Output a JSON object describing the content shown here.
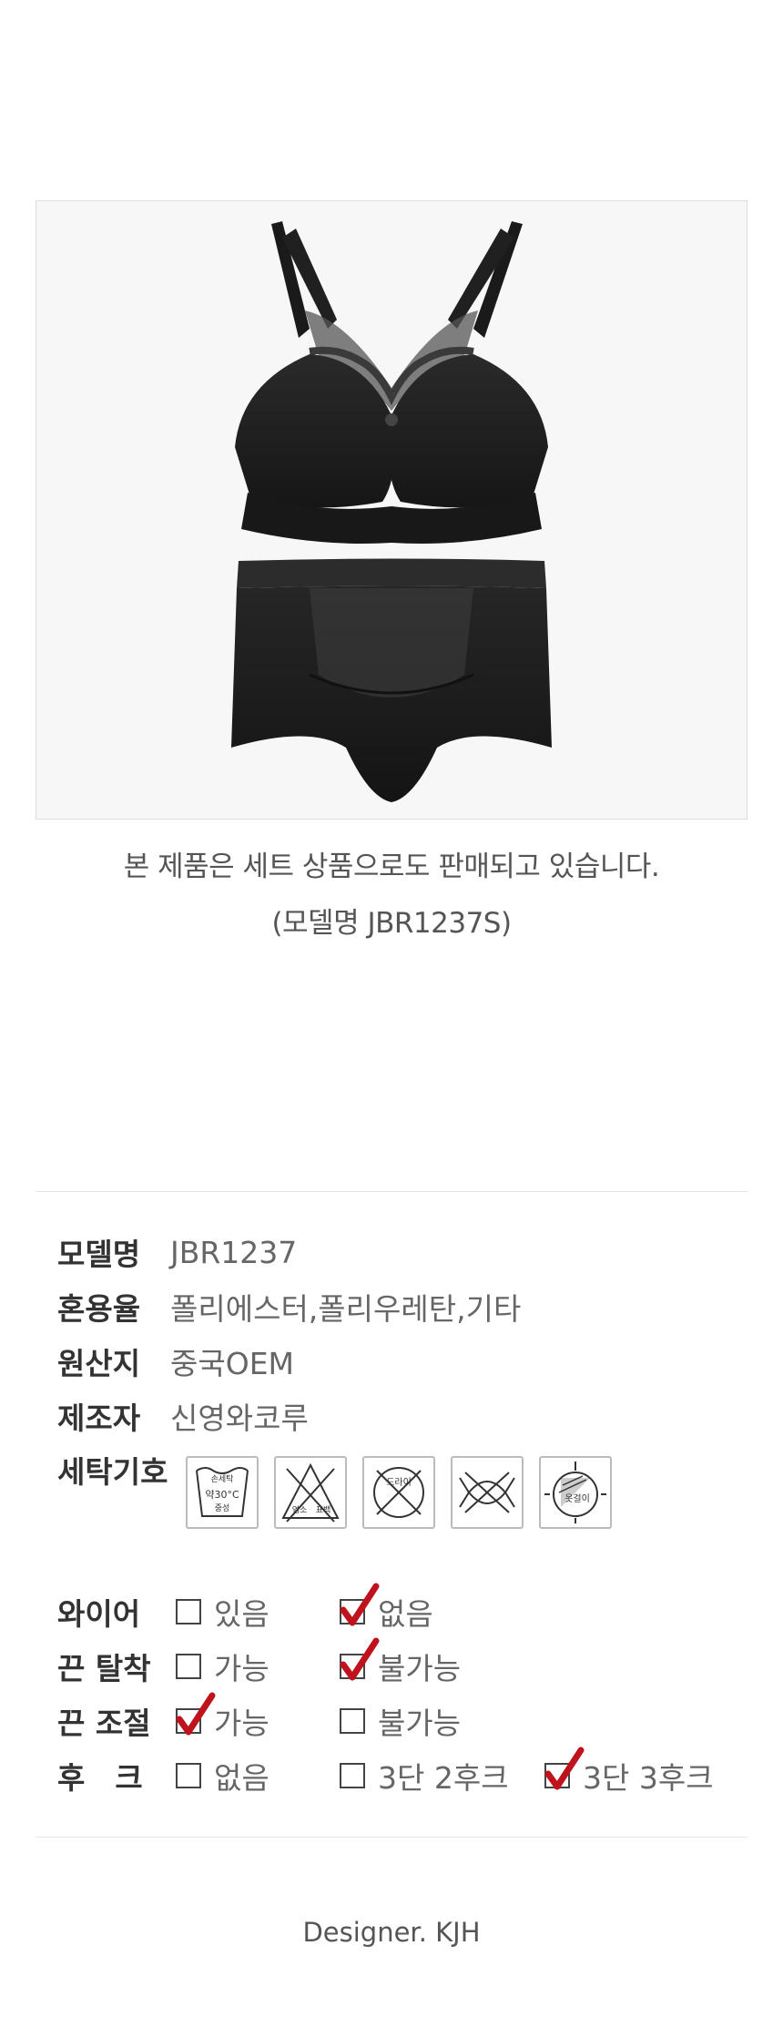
{
  "product_image": {
    "alt": "black bra and panty set"
  },
  "caption": {
    "line1": "본 제품은 세트 상품으로도 판매되고 있습니다.",
    "line2": "(모델명 JBR1237S)"
  },
  "info": [
    {
      "label": "모델명",
      "value": "JBR1237"
    },
    {
      "label": "혼용율",
      "value": "폴리에스터,폴리우레탄,기타"
    },
    {
      "label": "원산지",
      "value": "중국OEM"
    },
    {
      "label": "제조자",
      "value": "신영와코루"
    }
  ],
  "wash": {
    "label": "세탁기호",
    "icons": [
      {
        "name": "hand-wash-icon",
        "texts": [
          "손세탁",
          "약30°C",
          "중성"
        ]
      },
      {
        "name": "no-bleach-icon",
        "texts": [
          "염소",
          "표백"
        ]
      },
      {
        "name": "no-dryclean-icon",
        "texts": [
          "드라이"
        ]
      },
      {
        "name": "no-wring-icon",
        "texts": []
      },
      {
        "name": "shade-dry-icon",
        "texts": [
          "옷걸이"
        ]
      }
    ]
  },
  "options": [
    {
      "label": "와이어",
      "choices": [
        {
          "text": "있음",
          "checked": false
        },
        {
          "text": "없음",
          "checked": true
        }
      ]
    },
    {
      "label": "끈 탈착",
      "choices": [
        {
          "text": "가능",
          "checked": false
        },
        {
          "text": "불가능",
          "checked": true
        }
      ]
    },
    {
      "label": "끈 조절",
      "choices": [
        {
          "text": "가능",
          "checked": true
        },
        {
          "text": "불가능",
          "checked": false
        }
      ]
    },
    {
      "label": "후　크",
      "choices": [
        {
          "text": "없음",
          "checked": false
        },
        {
          "text": "3단 2후크",
          "checked": false
        },
        {
          "text": "3단 3후크",
          "checked": true
        }
      ]
    }
  ],
  "colors": {
    "check": "#c0121c",
    "garment": "#1e1e1e"
  },
  "footer": {
    "designer": "Designer. KJH"
  }
}
